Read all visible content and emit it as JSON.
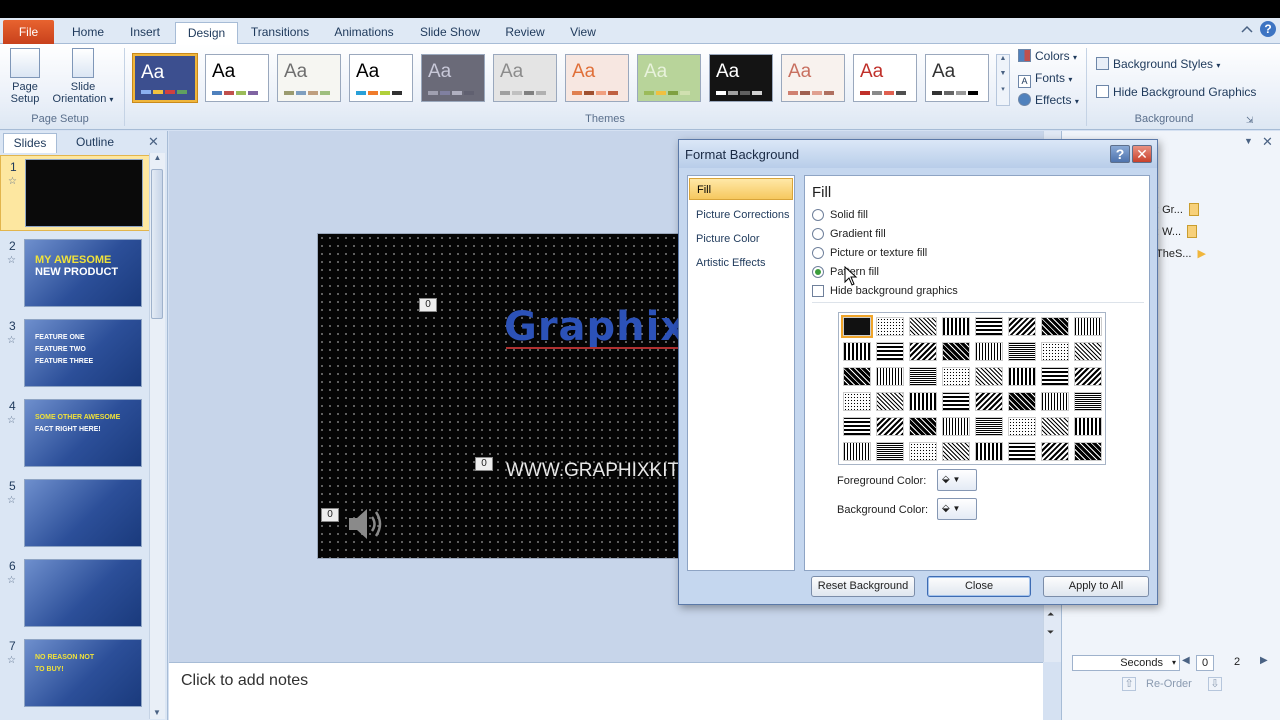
{
  "ribbon_tabs": [
    "File",
    "Home",
    "Insert",
    "Design",
    "Transitions",
    "Animations",
    "Slide Show",
    "Review",
    "View"
  ],
  "active_tab": "Design",
  "page_setup": {
    "page_setup_label_1": "Page",
    "page_setup_label_2": "Setup",
    "orientation_label_1": "Slide",
    "orientation_label_2": "Orientation",
    "group_label": "Page Setup"
  },
  "themes": {
    "group_label": "Themes",
    "tiles": [
      {
        "aa": "Aa",
        "bg": "#3c4f8f",
        "fg": "#ffffff",
        "bars": [
          "#8bb0f0",
          "#f0c040",
          "#d04040",
          "#60a060"
        ]
      },
      {
        "aa": "Aa",
        "bg": "#ffffff",
        "fg": "#000000",
        "bars": [
          "#4f81bd",
          "#c0504d",
          "#9bbb59",
          "#8064a2"
        ]
      },
      {
        "aa": "Aa",
        "bg": "#f6f6f2",
        "fg": "#6f6f6f",
        "bars": [
          "#9b9b6f",
          "#7f9fbf",
          "#bf9f7f",
          "#9fbf7f"
        ]
      },
      {
        "aa": "Aa",
        "bg": "#ffffff",
        "fg": "#000000",
        "bars": [
          "#29a0d8",
          "#f07c2c",
          "#b1d03a",
          "#333333"
        ]
      },
      {
        "aa": "Aa",
        "bg": "#6a6a78",
        "fg": "#c8c8d8",
        "bars": [
          "#a0a0b0",
          "#8080a0",
          "#b0b0c0",
          "#606070"
        ]
      },
      {
        "aa": "Aa",
        "bg": "#e4e4e4",
        "fg": "#8c8c8c",
        "bars": [
          "#a0a0a0",
          "#c0c0c0",
          "#808080",
          "#b0b0b0"
        ]
      },
      {
        "aa": "Aa",
        "bg": "#f7e7e1",
        "fg": "#e0703a",
        "bars": [
          "#e08050",
          "#a05030",
          "#f0a080",
          "#c06040"
        ]
      },
      {
        "aa": "Aa",
        "bg": "#b8d49a",
        "fg": "#e8f2dc",
        "bars": [
          "#9bbb59",
          "#f0c040",
          "#7fa040",
          "#d0e0b0"
        ]
      },
      {
        "aa": "Aa",
        "bg": "#141414",
        "fg": "#ffffff",
        "bars": [
          "#ffffff",
          "#a0a0a0",
          "#606060",
          "#d0d0d0"
        ]
      },
      {
        "aa": "Aa",
        "bg": "#f8f2ee",
        "fg": "#c87060",
        "bars": [
          "#d08070",
          "#a06050",
          "#e0a090",
          "#b07060"
        ]
      },
      {
        "aa": "Aa",
        "bg": "#ffffff",
        "fg": "#c0302a",
        "bars": [
          "#c0302a",
          "#8a8a8a",
          "#e06050",
          "#505050"
        ]
      },
      {
        "aa": "Aa",
        "bg": "#ffffff",
        "fg": "#333333",
        "bars": [
          "#333333",
          "#666666",
          "#999999",
          "#000000"
        ]
      }
    ]
  },
  "theme_options": {
    "colors": "Colors",
    "fonts": "Fonts",
    "effects": "Effects"
  },
  "background_group": {
    "styles": "Background Styles",
    "hide_graphics": "Hide Background Graphics",
    "group_label": "Background"
  },
  "slides_panel": {
    "tab_slides": "Slides",
    "tab_outline": "Outline",
    "slides": [
      {
        "num": "1",
        "dark": true,
        "lines": []
      },
      {
        "num": "2",
        "dark": false,
        "lines": [
          {
            "t": "MY AWESOME",
            "y": true
          },
          {
            "t": "NEW PRODUCT",
            "y": false
          }
        ]
      },
      {
        "num": "3",
        "dark": false,
        "lines": [
          {
            "t": "FEATURE ONE",
            "y": false
          },
          {
            "t": "FEATURE TWO",
            "y": false
          },
          {
            "t": "FEATURE THREE",
            "y": false
          }
        ]
      },
      {
        "num": "4",
        "dark": false,
        "lines": [
          {
            "t": "SOME OTHER AWESOME",
            "y": true
          },
          {
            "t": "FACT RIGHT HERE!",
            "y": false
          }
        ]
      },
      {
        "num": "5",
        "dark": false,
        "lines": []
      },
      {
        "num": "6",
        "dark": false,
        "lines": []
      },
      {
        "num": "7",
        "dark": false,
        "lines": [
          {
            "t": "NO REASON NOT",
            "y": true
          },
          {
            "t": "TO BUY!",
            "y": true
          }
        ]
      }
    ]
  },
  "slide": {
    "title": "Graphixkit",
    "url": "WWW.GRAPHIXKIT.COM",
    "tag": "0"
  },
  "notes_placeholder": "Click to add notes",
  "anim_pane": {
    "items": [
      ": Gr...",
      ": W...",
      "TheS..."
    ],
    "timing_unit": "Seconds",
    "timing_start": "0",
    "timing_end": "2",
    "reorder": "Re-Order"
  },
  "dialog": {
    "title": "Format Background",
    "help": "?",
    "close_glyph": "✕",
    "nav": [
      "Fill",
      "Picture Corrections",
      "Picture Color",
      "Artistic Effects"
    ],
    "active_nav": "Fill",
    "heading": "Fill",
    "options": [
      "Solid fill",
      "Gradient fill",
      "Picture or texture fill",
      "Pattern fill"
    ],
    "selected_option": "Pattern fill",
    "hide_bg": "Hide background graphics",
    "foreground_label": "Foreground Color:",
    "background_label": "Background Color:",
    "buttons": {
      "reset": "Reset Background",
      "close": "Close",
      "apply": "Apply to All"
    }
  }
}
